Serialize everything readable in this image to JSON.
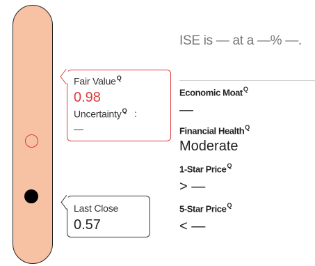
{
  "pill": {},
  "fair_value": {
    "label": "Fair Value",
    "q_icon": "Q",
    "value": "0.98",
    "uncertainty_label": "Uncertainty",
    "uncertainty_colon": ":",
    "uncertainty_value": "—"
  },
  "last_close": {
    "label": "Last Close",
    "value": "0.57"
  },
  "headline": "ISE is — at a —% —.",
  "metrics": {
    "economic_moat": {
      "label": "Economic Moat",
      "value": "—"
    },
    "financial_health": {
      "label": "Financial Health",
      "value": "Moderate"
    },
    "one_star": {
      "label": "1-Star Price",
      "prefix": ">",
      "value": "—"
    },
    "five_star": {
      "label": "5-Star Price",
      "prefix": "<",
      "value": "—"
    }
  },
  "colors": {
    "pill": "#f7c1a4",
    "accent_red": "#e03a3a"
  }
}
